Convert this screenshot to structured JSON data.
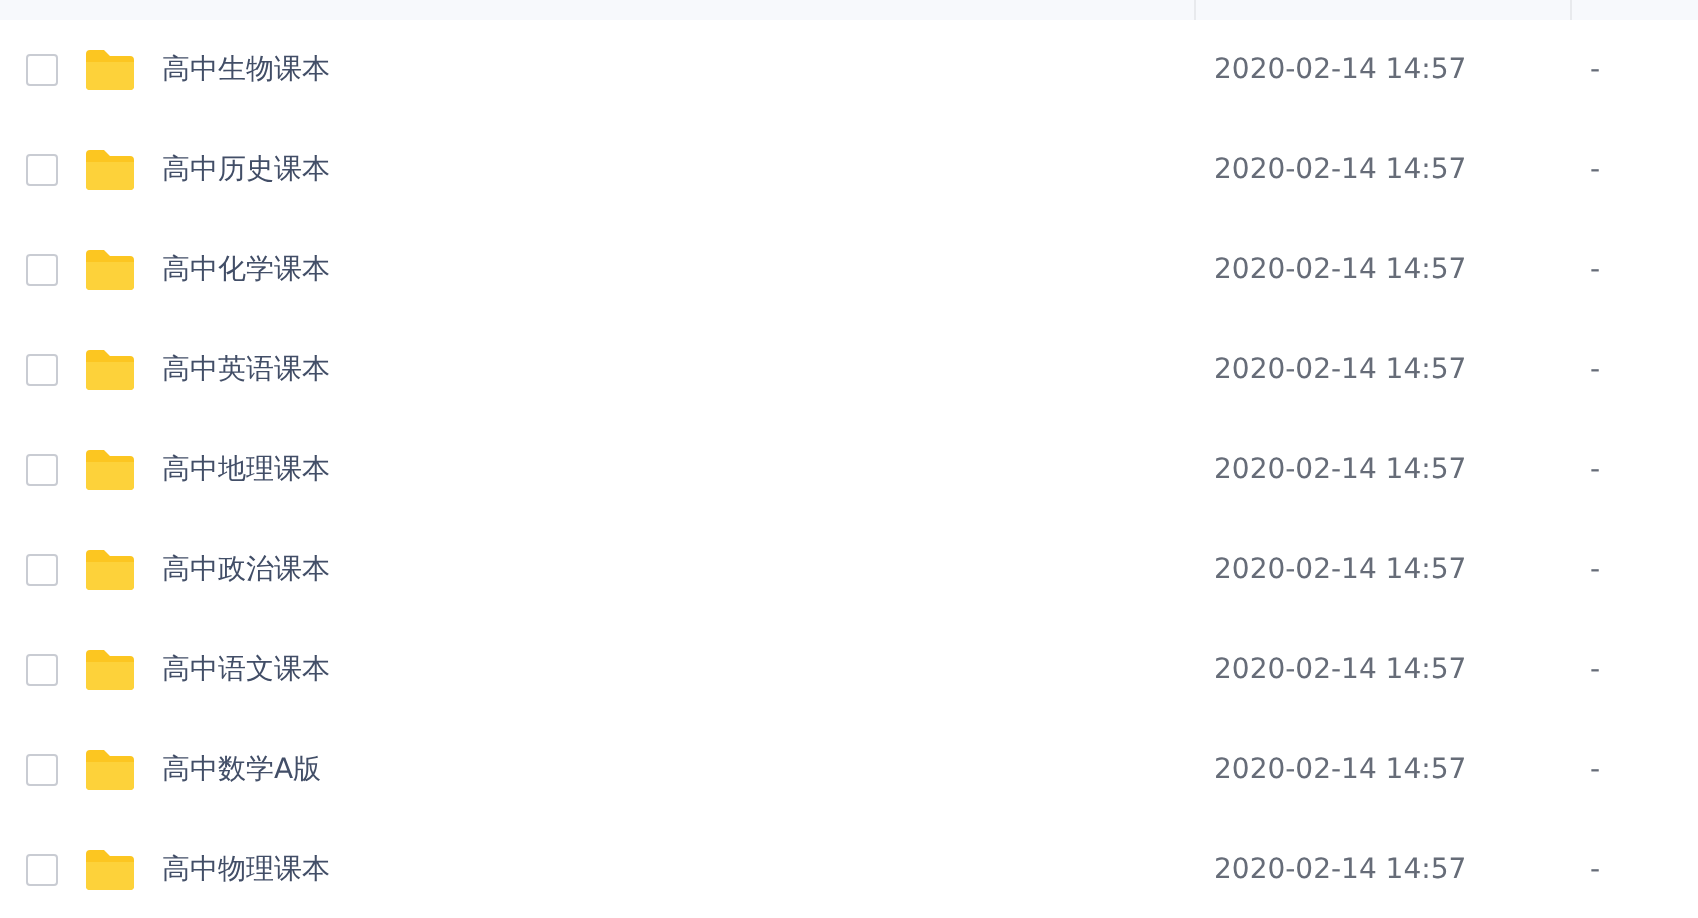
{
  "files": [
    {
      "name": "高中生物课本",
      "modified": "2020-02-14 14:57",
      "size": "-",
      "checked": false
    },
    {
      "name": "高中历史课本",
      "modified": "2020-02-14 14:57",
      "size": "-",
      "checked": false
    },
    {
      "name": "高中化学课本",
      "modified": "2020-02-14 14:57",
      "size": "-",
      "checked": false
    },
    {
      "name": "高中英语课本",
      "modified": "2020-02-14 14:57",
      "size": "-",
      "checked": false
    },
    {
      "name": "高中地理课本",
      "modified": "2020-02-14 14:57",
      "size": "-",
      "checked": false
    },
    {
      "name": "高中政治课本",
      "modified": "2020-02-14 14:57",
      "size": "-",
      "checked": false
    },
    {
      "name": "高中语文课本",
      "modified": "2020-02-14 14:57",
      "size": "-",
      "checked": false
    },
    {
      "name": "高中数学A版",
      "modified": "2020-02-14 14:57",
      "size": "-",
      "checked": false
    },
    {
      "name": "高中物理课本",
      "modified": "2020-02-14 14:57",
      "size": "-",
      "checked": false
    }
  ]
}
